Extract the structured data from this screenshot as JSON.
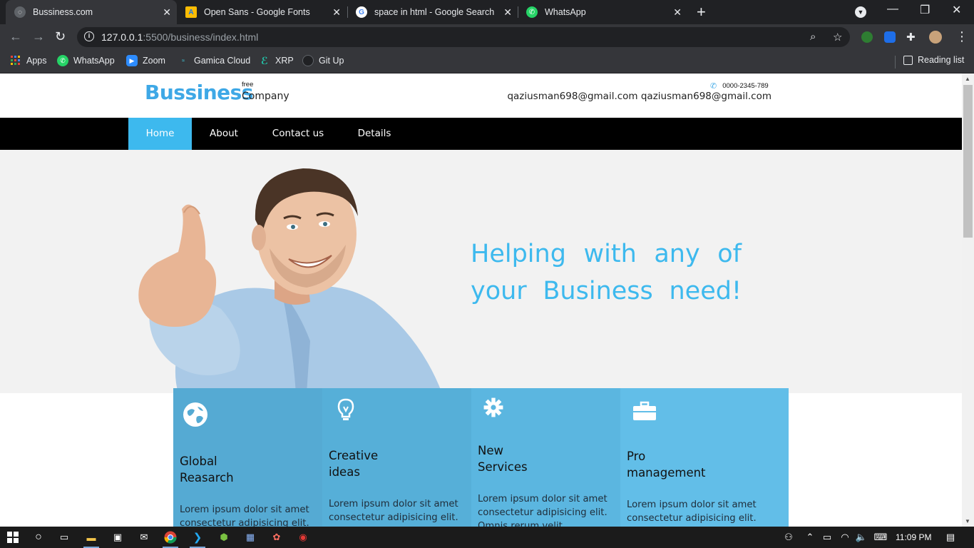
{
  "browser": {
    "tabs": [
      {
        "title": "Bussiness.com",
        "active": true
      },
      {
        "title": "Open Sans - Google Fonts",
        "active": false
      },
      {
        "title": "space in html - Google Search",
        "active": false
      },
      {
        "title": "WhatsApp",
        "active": false
      }
    ],
    "url_host": "127.0.0.1",
    "url_rest": ":5500/business/index.html",
    "bookmarks": [
      "Apps",
      "WhatsApp",
      "Zoom",
      "Gamica Cloud",
      "XRP",
      "Git Up"
    ],
    "reading_list": "Reading list"
  },
  "site": {
    "logo": "Bussiness",
    "logo_tag": "free",
    "logo_sub": "Company",
    "phone": "0000-2345-789",
    "emails": "qaziusman698@gmail.com qaziusman698@gmail.com",
    "nav": [
      "Home",
      "About",
      "Contact us",
      "Details"
    ],
    "hero_title": "Helping with any of your Business need!",
    "services": [
      {
        "title_line1": "Global",
        "title_line2": "Reasarch",
        "text": "Lorem ipsum dolor sit amet consectetur adipisicing elit.",
        "color": "#55aad3",
        "icon": "globe-icon"
      },
      {
        "title_line1": "Creative",
        "title_line2": "ideas",
        "text": "Lorem ipsum dolor sit amet consectetur adipisicing elit.",
        "color": "#56afd8",
        "icon": "lightbulb-icon"
      },
      {
        "title_line1": "New",
        "title_line2": "Services",
        "text": "Lorem ipsum dolor sit amet consectetur adipisicing elit. Omnis rerum velit",
        "color": "#5bb6e0",
        "icon": "gear-icon"
      },
      {
        "title_line1": "Pro",
        "title_line2": "management",
        "text": "Lorem ipsum dolor sit amet consectetur adipisicing elit.",
        "color": "#62bee8",
        "icon": "briefcase-icon"
      }
    ]
  },
  "taskbar": {
    "time": "11:09 PM"
  },
  "colors": {
    "accent": "#3db9ee",
    "logo": "#3ea8e6",
    "nav_bg": "#000000"
  }
}
